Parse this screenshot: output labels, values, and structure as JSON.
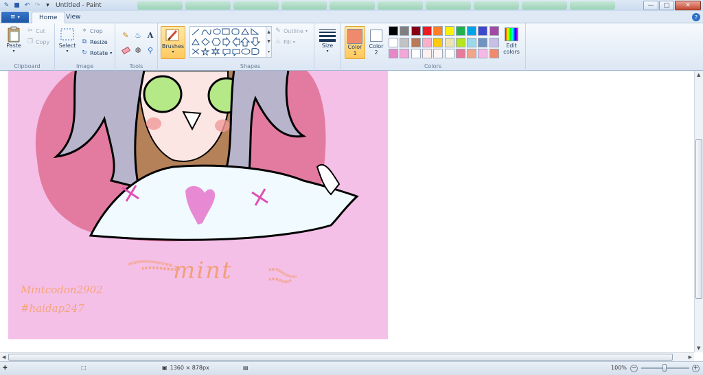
{
  "window": {
    "title": "Untitled - Paint",
    "controls": {
      "minimize": "—",
      "maximize": "□",
      "close": "✕"
    }
  },
  "ribbon_tabs": {
    "file": "≡",
    "home": "Home",
    "view": "View",
    "help": "?"
  },
  "clipboard": {
    "label": "Clipboard",
    "paste": "Paste",
    "cut": "Cut",
    "copy": "Copy"
  },
  "image": {
    "label": "Image",
    "select": "Select",
    "crop": "Crop",
    "resize": "Resize",
    "rotate": "Rotate"
  },
  "tools": {
    "label": "Tools",
    "text_glyph": "A"
  },
  "brushes": {
    "label": "Brushes"
  },
  "shapes": {
    "label": "Shapes",
    "outline": "Outline",
    "fill": "Fill"
  },
  "size": {
    "label": "Size"
  },
  "colors": {
    "label": "Colors",
    "color1_label": "Color",
    "color1_num": "1",
    "color2_label": "Color",
    "color2_num": "2",
    "edit_label": "Edit",
    "edit_label2": "colors",
    "color1_value": "#f08a6c",
    "color2_value": "#ffffff",
    "palette_row1": [
      "#000000",
      "#7f7f7f",
      "#880015",
      "#ed1c24",
      "#ff7f27",
      "#fff200",
      "#22b14c",
      "#00a2e8",
      "#3f48cc",
      "#a349a4"
    ],
    "palette_row2": [
      "#ffffff",
      "#c3c3c3",
      "#b97a57",
      "#ffaec9",
      "#ffc90e",
      "#efe4b0",
      "#b5e61d",
      "#99d9ea",
      "#7092be",
      "#c8bfe7"
    ],
    "palette_row3": [
      "#e887c8",
      "#f4a6d9",
      "#ffffff",
      "#fdf0ee",
      "#fff6f4",
      "#ffffff",
      "#e87a9a",
      "#f3a58c",
      "#f8b8e6",
      "#f08a6c"
    ]
  },
  "artwork": {
    "signature_line1": "Mintcodon2902",
    "signature_line2": "#haidap247",
    "name": "mint"
  },
  "statusbar": {
    "dimensions": "1360 × 878px",
    "zoom": "100%"
  }
}
